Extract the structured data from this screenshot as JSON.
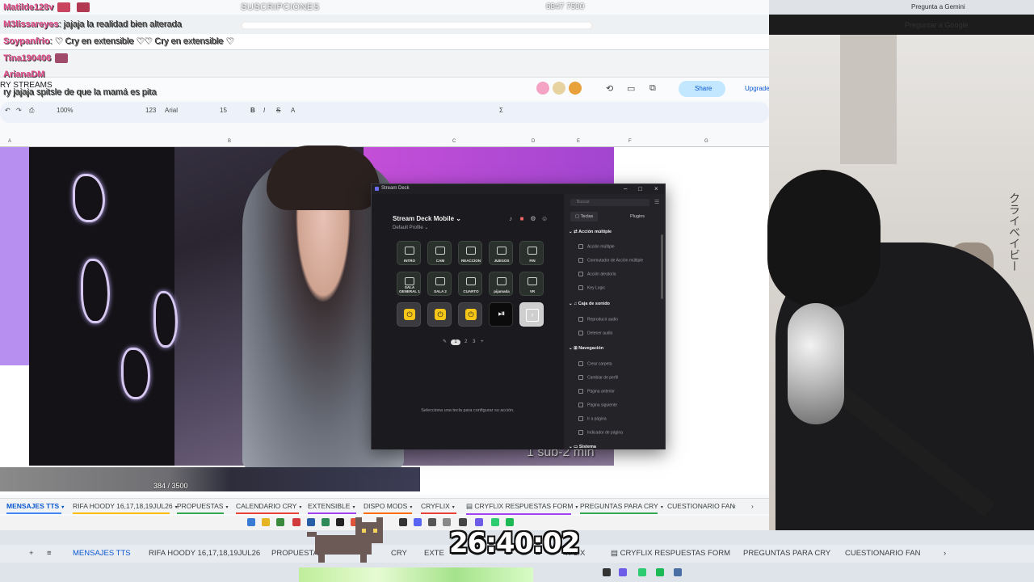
{
  "stream": {
    "subs_label": "SUSCRIPCIONES",
    "subs_count": "6847   7500",
    "goal_text": "384 / 3500",
    "sub_timer_text": "1 sub-2 min",
    "timer": "26:40:02",
    "japanese_text": "クライベイビー"
  },
  "chat": [
    {
      "name": "Matilde128v",
      "message": ""
    },
    {
      "name": "M3lissareyes",
      "message": ": jajaja la realidad bien alterada"
    },
    {
      "name": "Soypanfrio",
      "message": ": ♡ Cry en extensible ♡♡ Cry en extensible ♡"
    },
    {
      "name": "Tina190406",
      "message": ""
    },
    {
      "name": "ArianaDM",
      "message": ""
    },
    {
      "name": "",
      "message": "ry jajaja spitsle de que la mamá es pita"
    }
  ],
  "browser": {
    "gemini_label": "Pregunta a Gemini",
    "google_label": "Preguntar a Google",
    "doc_title": "RY STREAMS",
    "share_label": "Share",
    "upgrade_label": "Upgrade",
    "zoom": "100%",
    "font": "Arial",
    "font_size": "15",
    "format_123": "123",
    "column_letters": [
      "A",
      "B",
      "C",
      "D",
      "E",
      "F",
      "G"
    ]
  },
  "stream_deck": {
    "window_title": "Stream Deck",
    "device": "Stream Deck Mobile",
    "profile": "Default Profile",
    "keys_row1": [
      "INTRO",
      "CAM",
      "REACCION",
      "JUEGOS",
      "FIN"
    ],
    "keys_row2": [
      "SALA GENERAL 1",
      "SALA 2",
      "CUARTO",
      "pijamada",
      "VR"
    ],
    "pages": [
      "1",
      "2",
      "3"
    ],
    "hint": "Selecciona una tecla para configurar su acción.",
    "search_placeholder": "Buscar",
    "tabs": [
      "Teclas",
      "Plugins"
    ],
    "categories": [
      {
        "name": "Acción múltiple",
        "items": [
          "Acción múltiple",
          "Conmutador de Acción múltiple",
          "Acción aleatoria",
          "Key Logic"
        ]
      },
      {
        "name": "Caja de sonido",
        "items": [
          "Reproducir audio",
          "Detener audio"
        ]
      },
      {
        "name": "Navegación",
        "items": [
          "Crear carpeta",
          "Cambiar de perfil",
          "Página anterior",
          "Página siguiente",
          "Ir a página",
          "Indicador de página"
        ]
      },
      {
        "name": "Sistema",
        "items": []
      }
    ]
  },
  "sheet_tabs": [
    {
      "label": "MENSAJES TTS",
      "active": true,
      "color": "#4285f4"
    },
    {
      "label": "RIFA HOODY 16,17,18,19JUL26",
      "active": false,
      "color": "#fbbc04"
    },
    {
      "label": "PROPUESTAS",
      "active": false,
      "color": "#34a853"
    },
    {
      "label": "CALENDARIO CRY",
      "active": false,
      "color": "#ea4335"
    },
    {
      "label": "EXTENSIBLE",
      "active": false,
      "color": "#a142f4"
    },
    {
      "label": "DISPO MODS",
      "active": false,
      "color": "#ff6d01"
    },
    {
      "label": "CRYFLIX",
      "active": false,
      "color": "#ea4335"
    },
    {
      "label": "CRYFLIX RESPUESTAS FORM",
      "active": false,
      "color": "#a142f4"
    },
    {
      "label": "PREGUNTAS PARA CRY",
      "active": false,
      "color": "#34a853"
    },
    {
      "label": "CUESTIONARIO FAN",
      "active": false,
      "color": "#4285f4"
    }
  ],
  "bottom_tabs": [
    "MENSAJES TTS",
    "RIFA HOODY 16,17,18,19JUL26",
    "PROPUESTAS",
    "CRY",
    "EXTE",
    "YFLIX",
    "CRYFLIX RESPUESTAS FORM",
    "PREGUNTAS PARA CRY",
    "CUESTIONARIO FAN"
  ],
  "colors": {
    "accent": "#0b57d0",
    "power_key": "#f5c518",
    "chat_name": "#e24a8b"
  }
}
